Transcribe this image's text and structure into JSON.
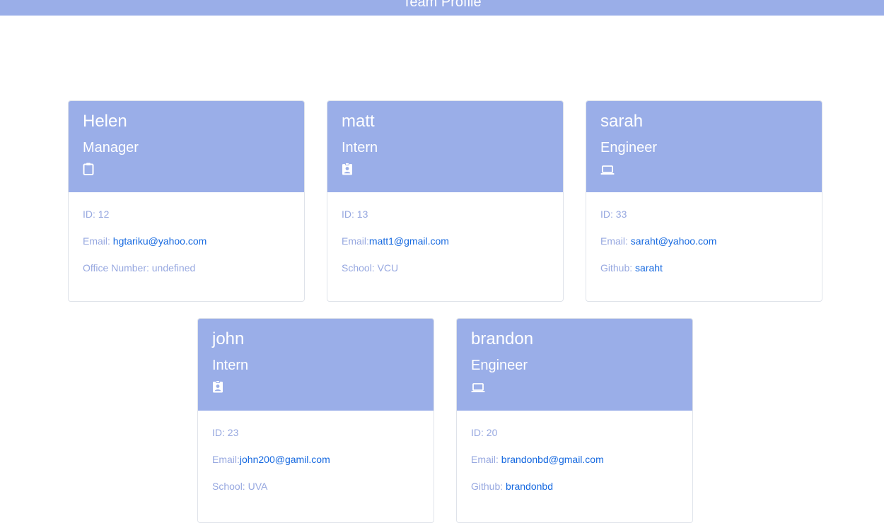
{
  "header": {
    "title": "Team Profile"
  },
  "cards": [
    {
      "name": "Helen",
      "role": "Manager",
      "icon": "clipboard-icon",
      "id_label": "ID: 12",
      "email_prefix": "Email: ",
      "email": "hgtariku@yahoo.com",
      "extra_label": "Office Number: undefined"
    },
    {
      "name": "matt",
      "role": "Intern",
      "icon": "id-badge-icon",
      "id_label": "ID: 13",
      "email_prefix": "Email:",
      "email": "matt1@gmail.com",
      "extra_label": "School: VCU"
    },
    {
      "name": "sarah",
      "role": "Engineer",
      "icon": "laptop-icon",
      "id_label": "ID: 33",
      "email_prefix": "Email: ",
      "email": "saraht@yahoo.com",
      "extra_prefix": "Github: ",
      "extra_link": "saraht"
    },
    {
      "name": "john",
      "role": "Intern",
      "icon": "id-badge-icon",
      "id_label": "ID: 23",
      "email_prefix": "Email:",
      "email": "john200@gamil.com",
      "extra_label": "School: UVA"
    },
    {
      "name": "brandon",
      "role": "Engineer",
      "icon": "laptop-icon",
      "id_label": "ID: 20",
      "email_prefix": "Email: ",
      "email": "brandonbd@gmail.com",
      "extra_prefix": "Github: ",
      "extra_link": "brandonbd"
    }
  ],
  "colors": {
    "header_bg": "#9aaee8",
    "muted_text": "#97a8e0",
    "link": "#1669e0"
  }
}
